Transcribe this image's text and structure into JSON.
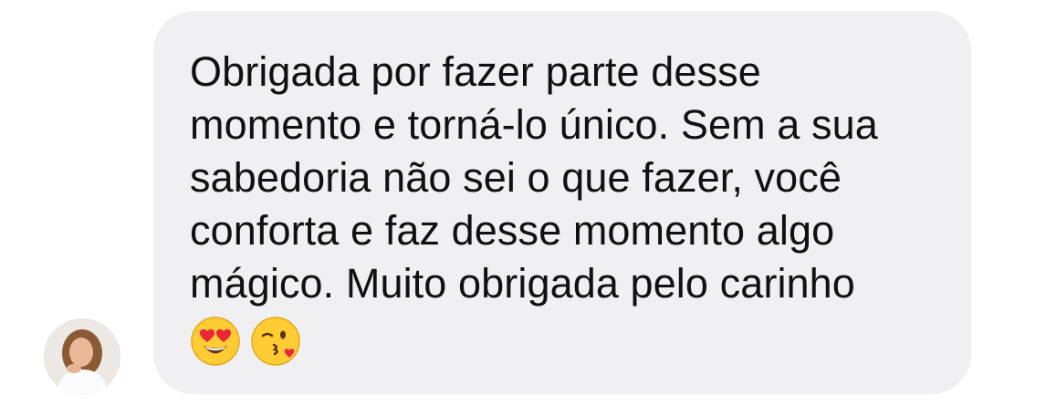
{
  "message": {
    "text": "Obrigada por fazer parte desse\nmomento e torná-lo único. Sem a sua\nsabedoria não sei o que fazer, você\nconforta e faz desse momento algo\nmágico. Muito obrigada pelo carinho",
    "emojis": [
      "heart-eyes-emoji",
      "kissing-face-emoji"
    ]
  },
  "colors": {
    "bubble_background": "#f0f0f3",
    "text": "#111111",
    "background": "#ffffff"
  },
  "sender": {
    "avatar_icon": "profile-photo"
  }
}
